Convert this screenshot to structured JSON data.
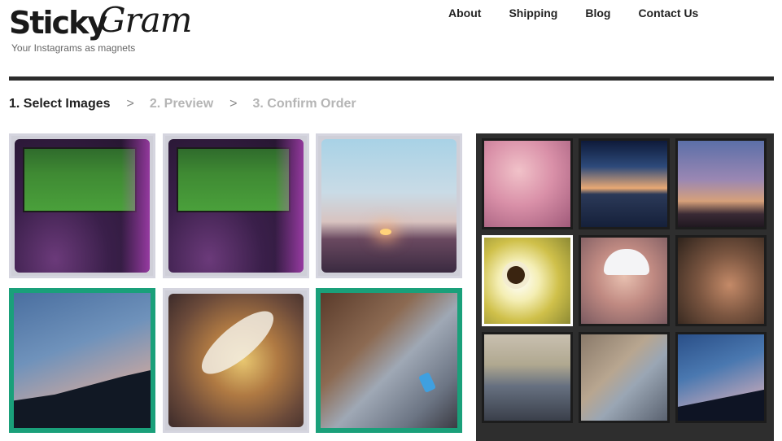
{
  "header": {
    "logo_sticky": "Sticky",
    "logo_gram": "Gram",
    "tagline": "Your Instagrams as magnets",
    "nav": [
      "About",
      "Shipping",
      "Blog",
      "Contact Us"
    ]
  },
  "steps": {
    "step1": "1. Select Images",
    "step2": "2. Preview",
    "step3": "3. Confirm Order",
    "separator": ">"
  },
  "colors": {
    "selected_border": "#1aa07a",
    "panel_background": "#2e2e2e",
    "header_rule": "#2b2b2b"
  },
  "left_grid": {
    "images": [
      {
        "subject": "tv-football",
        "selected": false
      },
      {
        "subject": "tv-football",
        "selected": false
      },
      {
        "subject": "sunset-sky",
        "selected": false
      },
      {
        "subject": "contrail-sky",
        "selected": true
      },
      {
        "subject": "food-plate",
        "selected": false
      },
      {
        "subject": "legs-phone",
        "selected": true
      }
    ]
  },
  "right_panel": {
    "thumbnails": [
      {
        "subject": "newborn-pink-blanket",
        "selected": false
      },
      {
        "subject": "lake-sunset",
        "selected": false
      },
      {
        "subject": "palm-trees",
        "selected": false
      },
      {
        "subject": "coffee-cup",
        "selected": true
      },
      {
        "subject": "baby-white-hat",
        "selected": false
      },
      {
        "subject": "couple",
        "selected": false
      },
      {
        "subject": "boy-selfie",
        "selected": false
      },
      {
        "subject": "legs-phone",
        "selected": false
      },
      {
        "subject": "contrail-sky",
        "selected": false
      }
    ]
  }
}
